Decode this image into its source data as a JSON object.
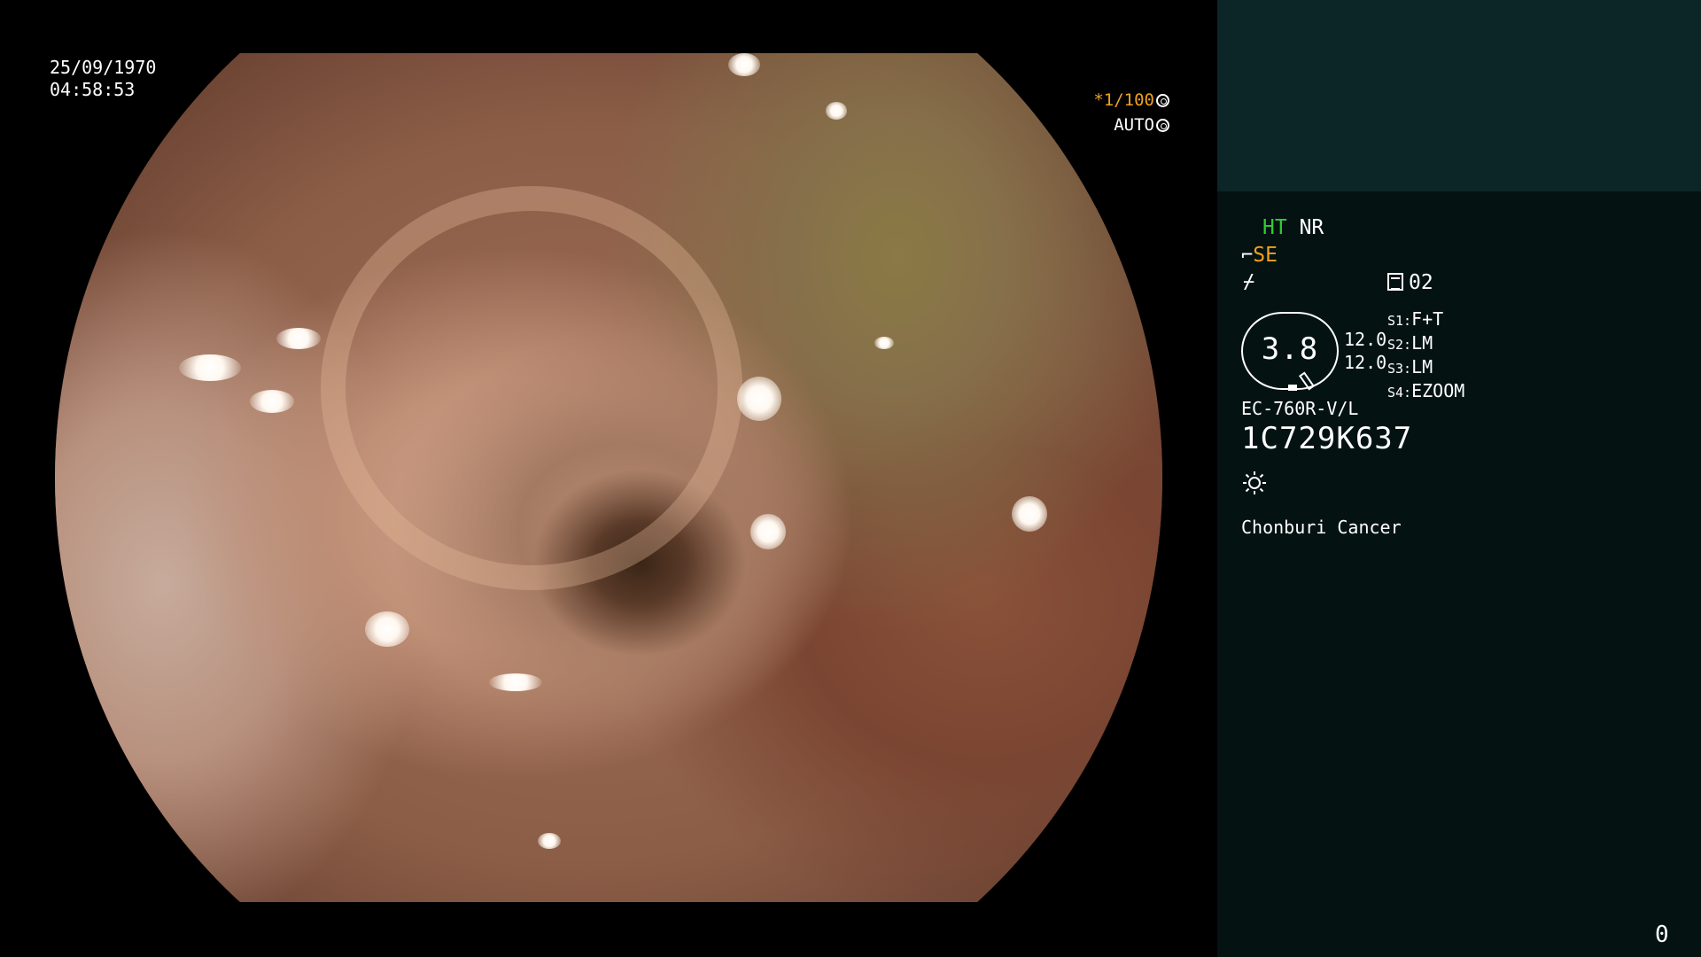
{
  "overlay": {
    "date": "25/09/1970",
    "time": "04:58:53",
    "shutter_speed": "*1/100",
    "iris_mode": "AUTO"
  },
  "panel": {
    "ht": "HT",
    "nr": "NR",
    "se": "SE",
    "memo_number": "02",
    "dial_value": "3.8",
    "range_top": "12.0",
    "range_bottom": "12.0",
    "settings": [
      {
        "key": "S1:",
        "value": "F+T"
      },
      {
        "key": "S2:",
        "value": "LM"
      },
      {
        "key": "S3:",
        "value": "LM"
      },
      {
        "key": "S4:",
        "value": "EZOOM"
      }
    ],
    "model": "EC-760R-V/L",
    "serial": "1C729K637",
    "institution": "Chonburi Cancer",
    "frame_count": "0"
  },
  "icons": {
    "shutter": "aperture-icon",
    "iris": "iris-icon",
    "structure": "enhancement-icon",
    "color": "color-mode-icon",
    "memo": "memo-icon",
    "light": "light-source-icon"
  },
  "colors": {
    "ht": "#33cc33",
    "se": "#f0a020",
    "shutter": "#f0a020",
    "panel_bg": "#041312",
    "panel_top_bg": "#0c2527"
  }
}
